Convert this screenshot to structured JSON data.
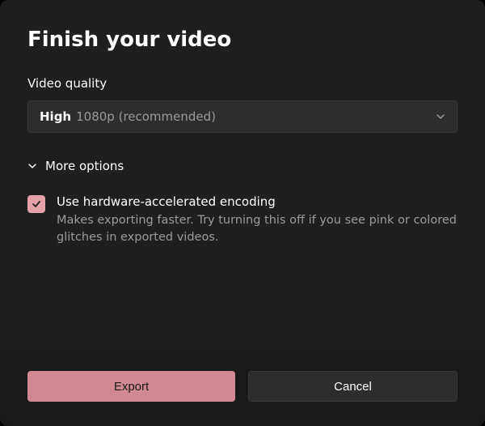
{
  "dialog": {
    "title": "Finish your video",
    "quality": {
      "label": "Video quality",
      "selected_high": "High",
      "selected_rest": "1080p (recommended)"
    },
    "more_options_label": "More options",
    "hw_encoding": {
      "title": "Use hardware-accelerated encoding",
      "desc": "Makes exporting faster. Try turning this off if you see pink or colored glitches in exported videos."
    },
    "buttons": {
      "export": "Export",
      "cancel": "Cancel"
    }
  }
}
